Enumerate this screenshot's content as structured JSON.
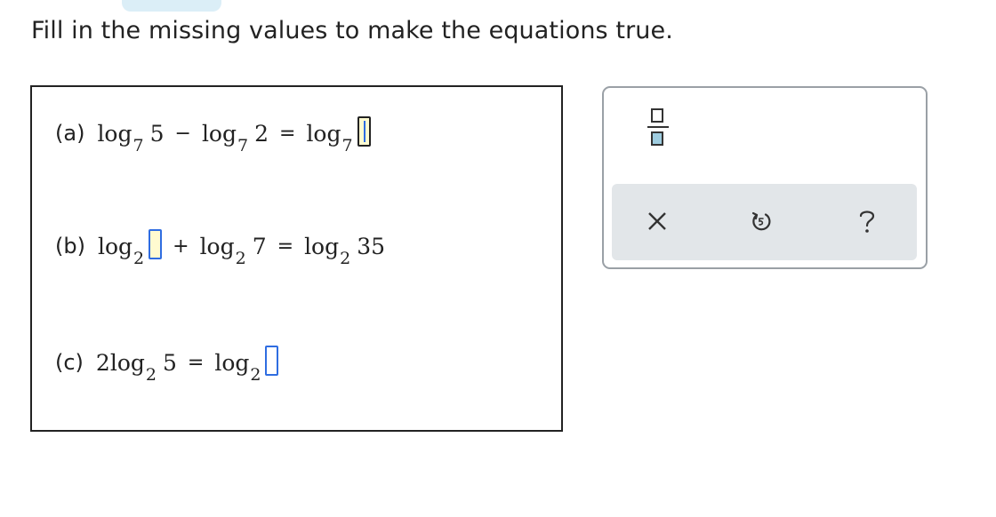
{
  "instruction": "Fill in the missing values to make the equations true.",
  "equations": {
    "a": {
      "label": "(a)",
      "log": "log",
      "base": "7",
      "arg1": "5",
      "minus": "−",
      "arg2": "2",
      "equals": "="
    },
    "b": {
      "label": "(b)",
      "log": "log",
      "base": "2",
      "plus": "+",
      "arg2": "7",
      "equals": "=",
      "result": "35"
    },
    "c": {
      "label": "(c)",
      "coef": "2",
      "log": "log",
      "base": "2",
      "arg1": "5",
      "equals": "="
    }
  },
  "keypad": {
    "fraction_icon": "fraction-template-icon",
    "close_icon": "close-icon",
    "undo_icon": "undo-icon",
    "help_icon": "help-icon"
  },
  "colors": {
    "answer_border": "#2f6de1",
    "answer_fill": "#fffbd0",
    "toolbar_bg": "#e2e6e9",
    "fraction_fill": "#9fcde0"
  }
}
